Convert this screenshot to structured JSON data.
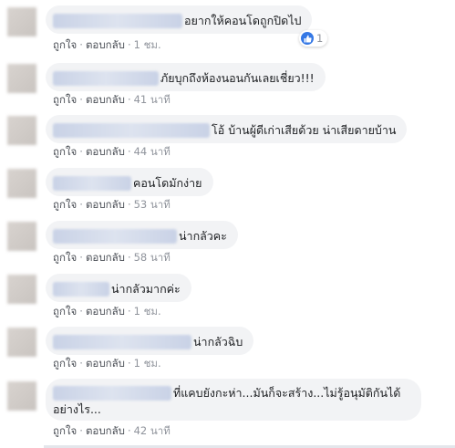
{
  "comments": [
    {
      "text": "อยากให้คอนโดถูกปิดไป",
      "like": "ถูกใจ",
      "reply": "ตอบกลับ",
      "time": "1 ชม.",
      "reaction_count": "1"
    },
    {
      "text": "ภัยบุกถึงห้องนอนกันเลยเชี่ยว!!!",
      "like": "ถูกใจ",
      "reply": "ตอบกลับ",
      "time": "41 นาที"
    },
    {
      "text": "โอ้ บ้านผู้ดีเก่าเสียด้วย น่าเสียดายบ้าน",
      "like": "ถูกใจ",
      "reply": "ตอบกลับ",
      "time": "44 นาที"
    },
    {
      "text": "คอนโดมักง่าย",
      "like": "ถูกใจ",
      "reply": "ตอบกลับ",
      "time": "53 นาที"
    },
    {
      "text": "น่ากลัวคะ",
      "like": "ถูกใจ",
      "reply": "ตอบกลับ",
      "time": "58 นาที"
    },
    {
      "text": "น่ากลัวมากค่ะ",
      "like": "ถูกใจ",
      "reply": "ตอบกลับ",
      "time": "1 ชม."
    },
    {
      "text": "น่ากลัวฉิบ",
      "like": "ถูกใจ",
      "reply": "ตอบกลับ",
      "time": "1 ชม."
    },
    {
      "text": "ที่แคบยังกะห่า...มันก็จะสร้าง...ไม่รู้อนุมัติกันได้อย่างไร...",
      "like": "ถูกใจ",
      "reply": "ตอบกลับ",
      "time": "42 นาที"
    }
  ],
  "colors": {
    "like_blue": "#3578e5",
    "bubble_bg": "#f2f3f5",
    "meta_gray": "#90949c"
  },
  "icons": {
    "reaction": "like-thumb-icon"
  }
}
